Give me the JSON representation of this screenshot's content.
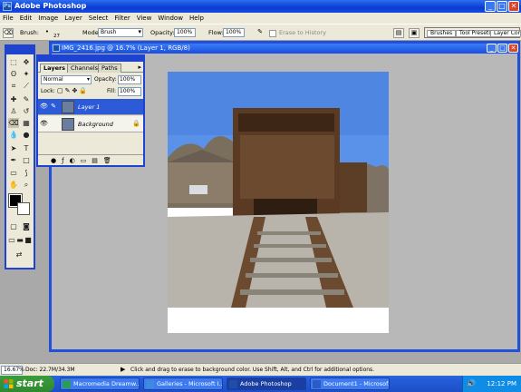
{
  "app": {
    "title": "Adobe Photoshop"
  },
  "window_buttons": {
    "minimize": "_",
    "maximize": "□",
    "close": "✕"
  },
  "menu": [
    "File",
    "Edit",
    "Image",
    "Layer",
    "Select",
    "Filter",
    "View",
    "Window",
    "Help"
  ],
  "options_bar": {
    "brush_label": "Brush:",
    "brush_size": "27",
    "mode_label": "Mode:",
    "mode_value": "Brush",
    "opacity_label": "Opacity:",
    "opacity_value": "100%",
    "flow_label": "Flow:",
    "flow_value": "100%",
    "erase_to_history": "Erase to History"
  },
  "palette_well": {
    "tab1": "Brushes",
    "tab2": "Tool Presets",
    "tab3": "Layer Comps"
  },
  "document": {
    "title": "IMG_2416.jpg @ 16.7% (Layer 1, RGB/8)"
  },
  "layers_panel": {
    "tabs": [
      "Layers",
      "Channels",
      "Paths"
    ],
    "blend_mode": "Normal",
    "opacity_label": "Opacity:",
    "opacity_value": "100%",
    "lock_label": "Lock:",
    "fill_label": "Fill:",
    "fill_value": "100%",
    "layers": [
      {
        "name": "Layer 1",
        "selected": true
      },
      {
        "name": "Background",
        "selected": false
      }
    ]
  },
  "status": {
    "zoom": "16.67%",
    "doc": "Doc: 22.7M/34.3M",
    "hint": "Click and drag to erase to background color.  Use Shift, Alt, and Ctrl for additional options."
  },
  "taskbar": {
    "start": "start",
    "tasks": [
      {
        "label": "Macromedia Dreamw...",
        "icon_color": "#2a9d5c",
        "active": false
      },
      {
        "label": "Galleries - Microsoft I...",
        "icon_color": "#3d8be0",
        "active": false
      },
      {
        "label": "Adobe Photoshop",
        "icon_color": "#1e4fa8",
        "active": true
      },
      {
        "label": "Document1 - Microsof...",
        "icon_color": "#2b5cc4",
        "active": false
      }
    ],
    "clock": "12:12 PM"
  }
}
